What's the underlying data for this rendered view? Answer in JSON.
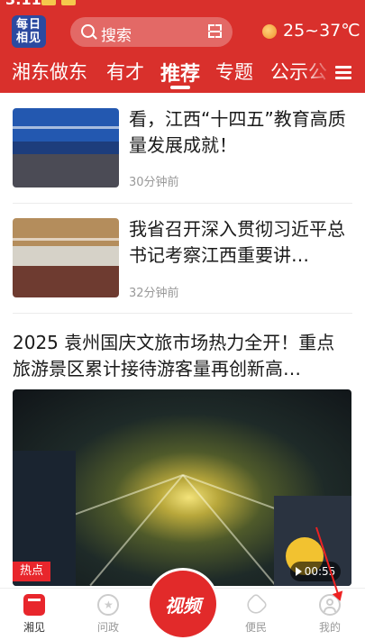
{
  "status": {
    "time": "3:11"
  },
  "header": {
    "logo": "每日相见",
    "search_placeholder": "搜索",
    "weather": "25~37℃"
  },
  "tabs": [
    "湘东做东",
    "有才",
    "推荐",
    "专题",
    "公示公"
  ],
  "active_tab": 2,
  "news": [
    {
      "title": "看，江西“十四五”教育高质量发展成就！",
      "time": "30分钟前"
    },
    {
      "title": "我省召开深入贯彻习近平总书记考察江西重要讲…",
      "time": "32分钟前"
    }
  ],
  "featured": {
    "title": "2025 袁州国庆文旅市场热力全开！重点旅游景区累计接待游客量再创新高…",
    "tag": "热点",
    "duration": "00:55"
  },
  "bottom_nav": {
    "items": [
      "湘见",
      "问政",
      "便民",
      "我的"
    ],
    "center_label": "视频"
  },
  "colors": {
    "brand": "#d9302c",
    "accent": "#e8262c"
  }
}
